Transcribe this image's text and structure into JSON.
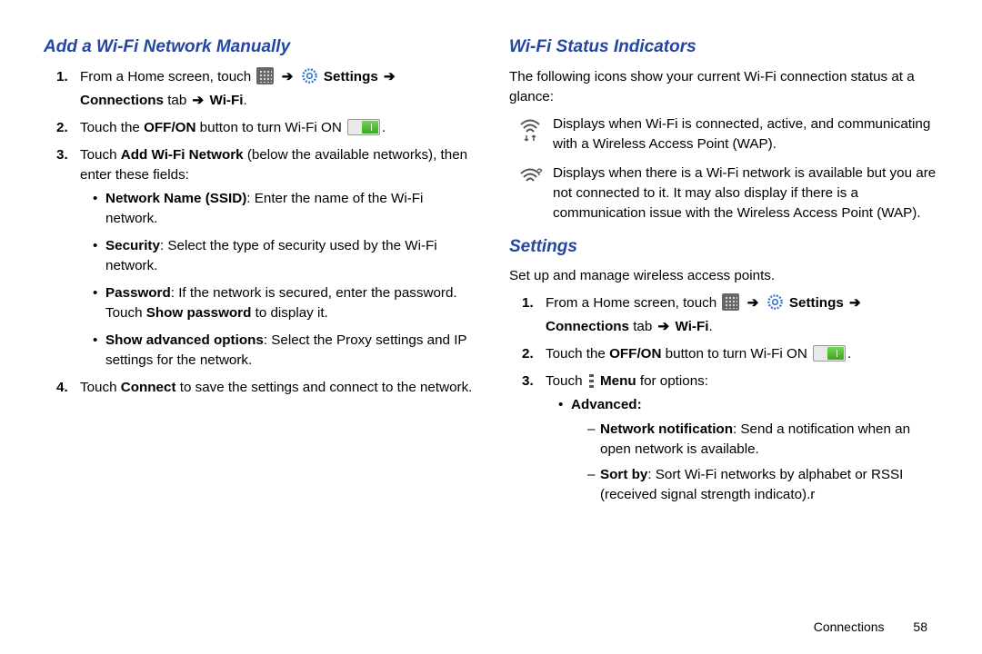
{
  "left": {
    "heading": "Add a Wi-Fi Network Manually",
    "step1_a": "From a Home screen, touch ",
    "step1_b": " Settings",
    "step1_c": "Connections",
    "step1_d": " tab ",
    "step1_e": " Wi-Fi",
    "step2_a": "Touch the ",
    "step2_b": "OFF/ON",
    "step2_c": " button to turn Wi-Fi ON ",
    "step3_a": "Touch ",
    "step3_b": "Add Wi-Fi Network",
    "step3_c": " (below the available networks), then enter these fields:",
    "b1_a": "Network Name (SSID)",
    "b1_b": ": Enter the name of the Wi-Fi network.",
    "b2_a": "Security",
    "b2_b": ": Select the type of security used by the Wi-Fi network.",
    "b3_a": "Password",
    "b3_b": ": If the network is secured, enter the password. Touch ",
    "b3_c": "Show password",
    "b3_d": " to display it.",
    "b4_a": "Show advanced options",
    "b4_b": ": Select the Proxy settings and IP settings for the network.",
    "step4_a": "Touch ",
    "step4_b": "Connect",
    "step4_c": " to save the settings and connect to the network."
  },
  "right": {
    "heading1": "Wi-Fi Status Indicators",
    "intro1": "The following icons show your current Wi-Fi connection status at a glance:",
    "ind1": "Displays when Wi-Fi is connected, active, and communicating with a Wireless Access Point (WAP).",
    "ind2": "Displays when there is a Wi-Fi network is available but you are not connected to it. It may also display if there is a communication issue with the Wireless Access Point (WAP).",
    "heading2": "Settings",
    "intro2": "Set up and manage wireless access points.",
    "s1_a": "From a Home screen, touch ",
    "s1_b": " Settings",
    "s1_c": "Connections",
    "s1_d": " tab ",
    "s1_e": " Wi-Fi",
    "s2_a": "Touch the ",
    "s2_b": "OFF/ON",
    "s2_c": " button to turn Wi-Fi ON ",
    "s3_a": "Touch ",
    "s3_b": " Menu",
    "s3_c": " for options:",
    "adv": "Advanced:",
    "d1_a": "Network notification",
    "d1_b": ": Send a notification when an open network is available.",
    "d2_a": "Sort by",
    "d2_b": ": Sort Wi-Fi networks by alphabet or RSSI (received signal strength indicato).r"
  },
  "footer": {
    "section": "Connections",
    "page": "58"
  },
  "arrow": "➔",
  "period": "."
}
